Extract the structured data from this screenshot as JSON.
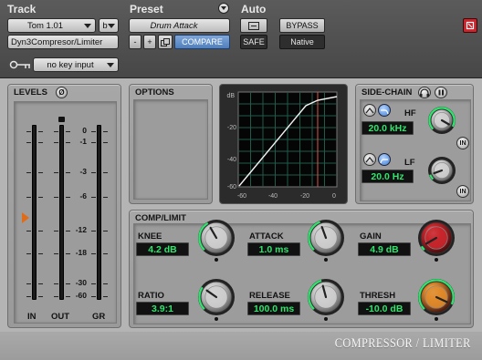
{
  "header": {
    "track_label": "Track",
    "preset_label": "Preset",
    "auto_label": "Auto",
    "track_name": "Tom 1.01",
    "channel": "b",
    "plugin_name": "Dyn3Compresor/Limiter",
    "preset_name": "Drum Attack",
    "minus": "-",
    "plus": "+",
    "compare": "COMPARE",
    "bypass": "BYPASS",
    "safe": "SAFE",
    "native": "Native",
    "key_input": "no key input"
  },
  "levels": {
    "title": "LEVELS",
    "phase": "Ø",
    "ticks": [
      "0",
      "-1",
      "-3",
      "-6",
      "-12",
      "-18",
      "-30",
      "-60"
    ],
    "in": "IN",
    "out": "OUT",
    "gr": "GR"
  },
  "options": {
    "title": "OPTIONS"
  },
  "graph": {
    "y_ticks": [
      "dB",
      "-20",
      "-40",
      "-60"
    ],
    "x_ticks": [
      "-60",
      "-40",
      "-20",
      "0"
    ]
  },
  "sidechain": {
    "title": "SIDE-CHAIN",
    "hf_label": "HF",
    "hf_value": "20.0 kHz",
    "lf_label": "LF",
    "lf_value": "20.0 Hz",
    "in": "IN"
  },
  "comp": {
    "title": "COMP/LIMIT",
    "knee_label": "KNEE",
    "knee_value": "4.2 dB",
    "attack_label": "ATTACK",
    "attack_value": "1.0 ms",
    "gain_label": "GAIN",
    "gain_value": "4.9 dB",
    "ratio_label": "RATIO",
    "ratio_value": "3.9:1",
    "release_label": "RELEASE",
    "release_value": "100.0 ms",
    "thresh_label": "THRESH",
    "thresh_value": "-10.0 dB"
  },
  "footer": {
    "brand": "COMPRESSOR / LIMITER"
  },
  "colors": {
    "value_text": "#2ee56d",
    "compare": "#5b8ac8",
    "gain_knob": "#c8262c",
    "thresh_knob": "#e08a2a",
    "close": "#c8262c"
  }
}
